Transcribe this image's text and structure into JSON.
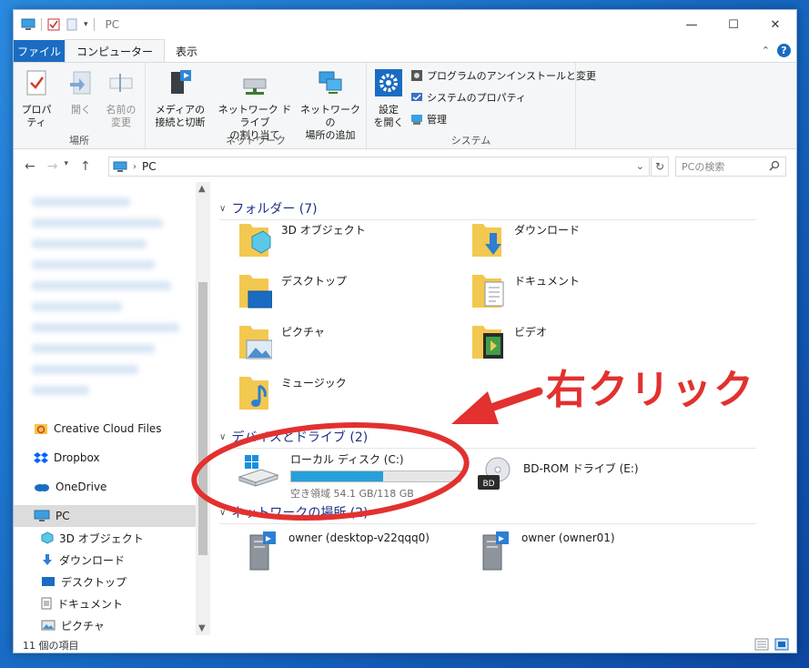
{
  "window": {
    "title": "PC",
    "controls": {
      "minimize": "—",
      "maximize": "☐",
      "close": "✕"
    }
  },
  "tabs": [
    "ファイル",
    "コンピューター",
    "表示"
  ],
  "ribbon": {
    "location": {
      "name": "場所",
      "properties": "プロパティ",
      "open": "開く",
      "rename_line1": "名前の",
      "rename_line2": "変更"
    },
    "network": {
      "name": "ネットワーク",
      "media_line1": "メディアの",
      "media_line2": "接続と切断",
      "map_line1": "ネットワーク ドライブ",
      "map_line2": "の割り当て",
      "add_line1": "ネットワークの",
      "add_line2": "場所の追加"
    },
    "system": {
      "name": "システム",
      "settings_line1": "設定",
      "settings_line2": "を開く",
      "uninstall": "プログラムのアンインストールと変更",
      "sysprops": "システムのプロパティ",
      "manage": "管理"
    }
  },
  "address": {
    "path": "PC",
    "search_placeholder": "PCの検索"
  },
  "nav_pane": {
    "items": [
      {
        "label": "Creative Cloud Files",
        "icon": "creative-cloud-icon"
      },
      {
        "label": "Dropbox",
        "icon": "dropbox-icon"
      },
      {
        "label": "OneDrive",
        "icon": "onedrive-icon"
      },
      {
        "label": "PC",
        "icon": "pc-icon"
      },
      {
        "label": "3D オブジェクト",
        "icon": "3d-objects-icon"
      },
      {
        "label": "ダウンロード",
        "icon": "download-icon"
      },
      {
        "label": "デスクトップ",
        "icon": "desktop-icon"
      },
      {
        "label": "ドキュメント",
        "icon": "document-icon"
      },
      {
        "label": "ピクチャ",
        "icon": "pictures-icon"
      }
    ]
  },
  "groups": {
    "folders": "フォルダー (7)",
    "drives": "デバイスとドライブ (2)",
    "network": "ネットワークの場所 (2)"
  },
  "folders": [
    {
      "label": "3D オブジェクト",
      "icon": "3d-folder-icon"
    },
    {
      "label": "ダウンロード",
      "icon": "download-folder-icon"
    },
    {
      "label": "デスクトップ",
      "icon": "desktop-folder-icon"
    },
    {
      "label": "ドキュメント",
      "icon": "documents-folder-icon"
    },
    {
      "label": "ピクチャ",
      "icon": "pictures-folder-icon"
    },
    {
      "label": "ビデオ",
      "icon": "videos-folder-icon"
    },
    {
      "label": "ミュージック",
      "icon": "music-folder-icon"
    }
  ],
  "drives": {
    "local": {
      "name": "ローカル ディスク (C:)",
      "free": "空き領域 54.1 GB/118 GB",
      "used_fraction": 0.542
    },
    "bd": {
      "name": "BD-ROM ドライブ (E:)"
    }
  },
  "network_locations": [
    {
      "label": "owner (desktop-v22qqq0)"
    },
    {
      "label": "owner (owner01)"
    }
  ],
  "status": {
    "count": "11 個の項目"
  },
  "annotation": {
    "text": "右クリック",
    "color": "#e2312f"
  }
}
